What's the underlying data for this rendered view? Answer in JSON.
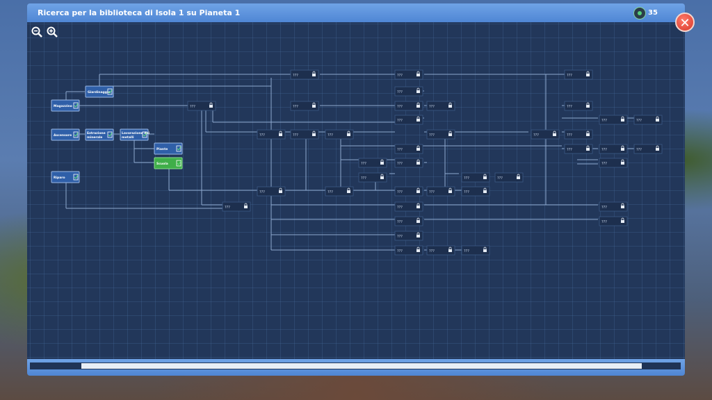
{
  "window": {
    "title": "Ricerca per la biblioteca di Isola 1 su Pianeta 1",
    "resource_icon": "research-points-icon",
    "resource_count": "35",
    "close_label": "✕"
  },
  "toolbar": {
    "zoom_out_icon": "zoom-out-icon",
    "zoom_in_icon": "zoom-in-icon"
  },
  "tree": {
    "unlocked": [
      {
        "id": "giardinaggio",
        "label": "Giardinaggio"
      },
      {
        "id": "magazzino",
        "label": "Magazzino"
      },
      {
        "id": "ascensore",
        "label": "Ascensore"
      },
      {
        "id": "estrazione",
        "label": "Estrazione minerale"
      },
      {
        "id": "lavorazione",
        "label": "Lavorazione dei metalli"
      },
      {
        "id": "piante",
        "label": "Piante"
      },
      {
        "id": "scuola",
        "label": "Scuola"
      },
      {
        "id": "riparo",
        "label": "Riparo"
      }
    ],
    "unknown_label": "???",
    "locked_icon": "lock-icon",
    "unlocked_icon": "checkmark-icon"
  },
  "progress": {
    "value": 0.935
  },
  "colors": {
    "accent": "#4f86d4",
    "panel": "#22375a",
    "selected": "#3fae49",
    "node": "#2f5fa8"
  }
}
